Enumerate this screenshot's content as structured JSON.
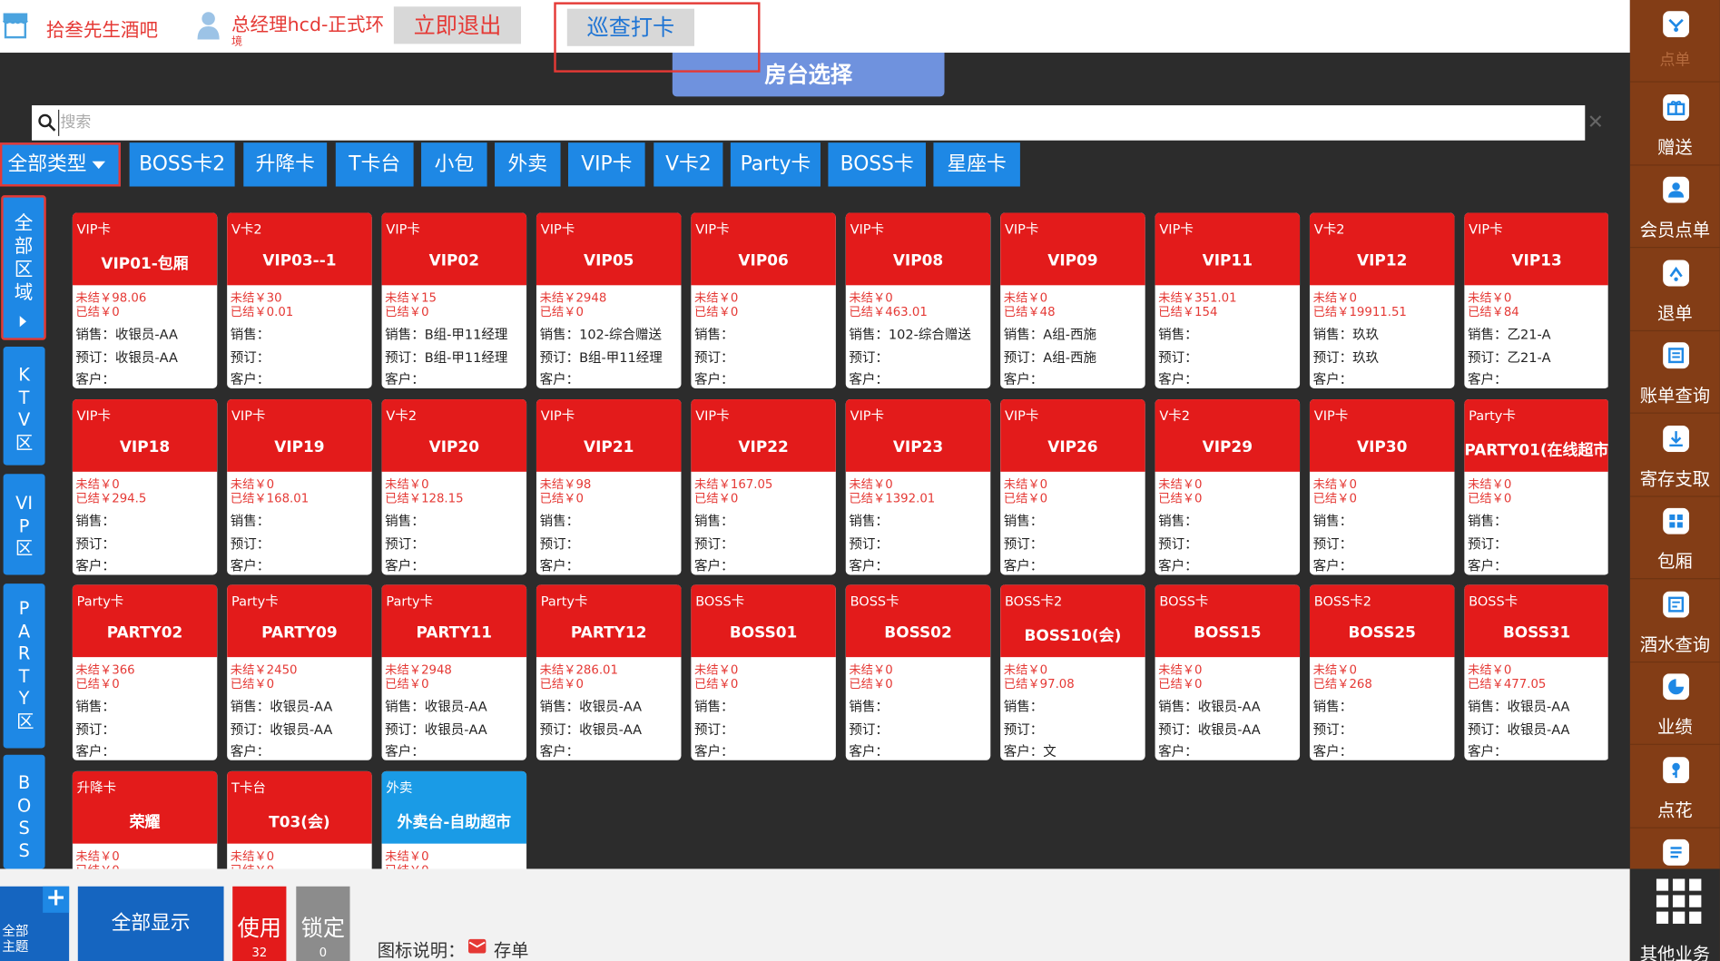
{
  "header": {
    "store_name": "拾叁先生酒吧",
    "user_name": "总经理hcd-正式环",
    "user_sub": "境",
    "exit_label": "立即退出",
    "patrol_label": "巡查打卡"
  },
  "room_select_title": "房台选择",
  "search": {
    "placeholder": "搜索",
    "value": ""
  },
  "type_filter": {
    "all_label": "全部类型",
    "tabs": [
      "BOSS卡2",
      "升降卡",
      "T卡台",
      "小包",
      "外卖",
      "VIP卡",
      "V卡2",
      "Party卡",
      "BOSS卡",
      "星座卡"
    ]
  },
  "zones": {
    "all_label": "全部区域",
    "items": [
      "KTV区",
      "VIP区",
      "PARTY区",
      "BOSS"
    ]
  },
  "labels": {
    "unsettled": "未结￥",
    "settled": "已结￥",
    "sales": "销售：",
    "reserve": "预订：",
    "customer": "客户："
  },
  "rooms": [
    {
      "type": "VIP卡",
      "name": "VIP01-包厢",
      "unsettled": "98.06",
      "settled": "0",
      "sales": "收银员-AA",
      "reserve": "收银员-AA",
      "customer": ""
    },
    {
      "type": "V卡2",
      "name": "VIP03--1",
      "unsettled": "30",
      "settled": "0.01",
      "sales": "",
      "reserve": "",
      "customer": ""
    },
    {
      "type": "VIP卡",
      "name": "VIP02",
      "unsettled": "15",
      "settled": "0",
      "sales": "B组-甲11经理",
      "reserve": "B组-甲11经理",
      "customer": ""
    },
    {
      "type": "VIP卡",
      "name": "VIP05",
      "unsettled": "2948",
      "settled": "0",
      "sales": "102-综合赠送",
      "reserve": "B组-甲11经理",
      "customer": ""
    },
    {
      "type": "VIP卡",
      "name": "VIP06",
      "unsettled": "0",
      "settled": "0",
      "sales": "",
      "reserve": "",
      "customer": ""
    },
    {
      "type": "VIP卡",
      "name": "VIP08",
      "unsettled": "0",
      "settled": "463.01",
      "sales": "102-综合赠送",
      "reserve": "",
      "customer": ""
    },
    {
      "type": "VIP卡",
      "name": "VIP09",
      "unsettled": "0",
      "settled": "48",
      "sales": "A组-西施",
      "reserve": "A组-西施",
      "customer": ""
    },
    {
      "type": "VIP卡",
      "name": "VIP11",
      "unsettled": "351.01",
      "settled": "154",
      "sales": "",
      "reserve": "",
      "customer": ""
    },
    {
      "type": "V卡2",
      "name": "VIP12",
      "unsettled": "0",
      "settled": "19911.51",
      "sales": "玖玖",
      "reserve": "玖玖",
      "customer": ""
    },
    {
      "type": "VIP卡",
      "name": "VIP13",
      "unsettled": "0",
      "settled": "84",
      "sales": "乙21-A",
      "reserve": "乙21-A",
      "customer": ""
    },
    {
      "type": "VIP卡",
      "name": "VIP18",
      "unsettled": "0",
      "settled": "294.5",
      "sales": "",
      "reserve": "",
      "customer": ""
    },
    {
      "type": "VIP卡",
      "name": "VIP19",
      "unsettled": "0",
      "settled": "168.01",
      "sales": "",
      "reserve": "",
      "customer": ""
    },
    {
      "type": "V卡2",
      "name": "VIP20",
      "unsettled": "0",
      "settled": "128.15",
      "sales": "",
      "reserve": "",
      "customer": ""
    },
    {
      "type": "VIP卡",
      "name": "VIP21",
      "unsettled": "98",
      "settled": "0",
      "sales": "",
      "reserve": "",
      "customer": ""
    },
    {
      "type": "VIP卡",
      "name": "VIP22",
      "unsettled": "167.05",
      "settled": "0",
      "sales": "",
      "reserve": "",
      "customer": ""
    },
    {
      "type": "VIP卡",
      "name": "VIP23",
      "unsettled": "0",
      "settled": "1392.01",
      "sales": "",
      "reserve": "",
      "customer": ""
    },
    {
      "type": "VIP卡",
      "name": "VIP26",
      "unsettled": "0",
      "settled": "0",
      "sales": "",
      "reserve": "",
      "customer": ""
    },
    {
      "type": "V卡2",
      "name": "VIP29",
      "unsettled": "0",
      "settled": "0",
      "sales": "",
      "reserve": "",
      "customer": ""
    },
    {
      "type": "VIP卡",
      "name": "VIP30",
      "unsettled": "0",
      "settled": "0",
      "sales": "",
      "reserve": "",
      "customer": ""
    },
    {
      "type": "Party卡",
      "name": "PARTY01(在线超市)",
      "unsettled": "0",
      "settled": "0",
      "sales": "",
      "reserve": "",
      "customer": ""
    },
    {
      "type": "Party卡",
      "name": "PARTY02",
      "unsettled": "366",
      "settled": "0",
      "sales": "",
      "reserve": "",
      "customer": ""
    },
    {
      "type": "Party卡",
      "name": "PARTY09",
      "unsettled": "2450",
      "settled": "0",
      "sales": "收银员-AA",
      "reserve": "收银员-AA",
      "customer": ""
    },
    {
      "type": "Party卡",
      "name": "PARTY11",
      "unsettled": "2948",
      "settled": "0",
      "sales": "收银员-AA",
      "reserve": "收银员-AA",
      "customer": ""
    },
    {
      "type": "Party卡",
      "name": "PARTY12",
      "unsettled": "286.01",
      "settled": "0",
      "sales": "收银员-AA",
      "reserve": "收银员-AA",
      "customer": ""
    },
    {
      "type": "BOSS卡",
      "name": "BOSS01",
      "unsettled": "0",
      "settled": "0",
      "sales": "",
      "reserve": "",
      "customer": ""
    },
    {
      "type": "BOSS卡",
      "name": "BOSS02",
      "unsettled": "0",
      "settled": "0",
      "sales": "",
      "reserve": "",
      "customer": ""
    },
    {
      "type": "BOSS卡2",
      "name": "BOSS10(会)",
      "unsettled": "0",
      "settled": "97.08",
      "sales": "",
      "reserve": "",
      "customer": "文"
    },
    {
      "type": "BOSS卡",
      "name": "BOSS15",
      "unsettled": "0",
      "settled": "0",
      "sales": "收银员-AA",
      "reserve": "收银员-AA",
      "customer": ""
    },
    {
      "type": "BOSS卡2",
      "name": "BOSS25",
      "unsettled": "0",
      "settled": "268",
      "sales": "",
      "reserve": "",
      "customer": ""
    },
    {
      "type": "BOSS卡",
      "name": "BOSS31",
      "unsettled": "0",
      "settled": "477.05",
      "sales": "收银员-AA",
      "reserve": "收银员-AA",
      "customer": ""
    },
    {
      "type": "升降卡",
      "name": "荣耀",
      "unsettled": "0",
      "settled": "0",
      "sales": "",
      "reserve": "",
      "customer": ""
    },
    {
      "type": "T卡台",
      "name": "T03(会)",
      "unsettled": "0",
      "settled": "0",
      "sales": "",
      "reserve": "",
      "customer": ""
    },
    {
      "type": "外卖",
      "name": "外卖台-自助超市",
      "unsettled": "0",
      "settled": "0",
      "sales": "",
      "reserve": "",
      "customer": "",
      "color": "#1a9be6"
    }
  ],
  "bottom": {
    "theme_label": "全部\n主题",
    "show_all_label": "全部显示",
    "use_label": "使用",
    "use_count": "32",
    "lock_label": "锁定",
    "lock_count": "0",
    "legend_label": "图标说明：",
    "legend_item": "存单"
  },
  "sidebar": [
    {
      "label": "点单",
      "icon": "order-icon",
      "dim": true
    },
    {
      "label": "赠送",
      "icon": "gift-icon"
    },
    {
      "label": "会员点单",
      "icon": "member-order-icon"
    },
    {
      "label": "退单",
      "icon": "refund-icon"
    },
    {
      "label": "账单查询",
      "icon": "bill-query-icon"
    },
    {
      "label": "寄存支取",
      "icon": "storage-icon"
    },
    {
      "label": "包厢",
      "icon": "room-icon"
    },
    {
      "label": "酒水查询",
      "icon": "drink-query-icon"
    },
    {
      "label": "业绩",
      "icon": "performance-icon"
    },
    {
      "label": "点花",
      "icon": "flower-icon"
    },
    {
      "label": "",
      "icon": "list-icon"
    }
  ],
  "other_business": "其他业务",
  "colors": {
    "card_red": "#e31b1b",
    "accent_blue": "#1e88e5",
    "sidebar_brown": "#833d16",
    "highlight_red": "#e53935"
  }
}
